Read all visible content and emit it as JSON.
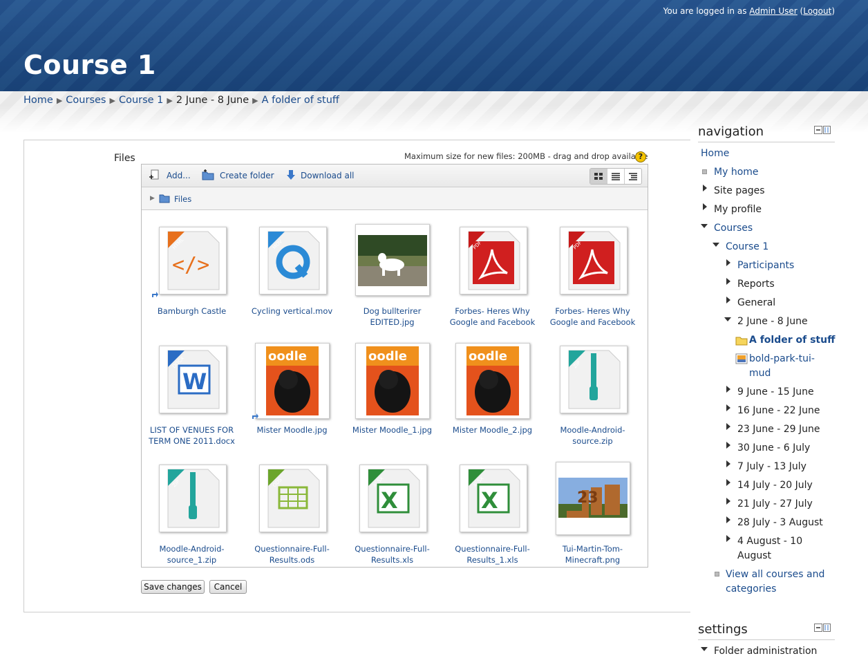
{
  "header": {
    "login_prefix": "You are logged in as",
    "user": "Admin User",
    "logout": "Logout",
    "course_title": "Course 1"
  },
  "breadcrumb": {
    "items": [
      "Home",
      "Courses",
      "Course 1",
      "2 June - 8 June",
      "A folder of stuff"
    ]
  },
  "files_form": {
    "label": "Files",
    "max_size": "Maximum size for new files: 200MB - drag and drop available",
    "toolbar": {
      "add": "Add...",
      "create_folder": "Create folder",
      "download_all": "Download all"
    },
    "path": "Files",
    "files": [
      {
        "name": "Bamburgh Castle",
        "icon": "html-file-icon"
      },
      {
        "name": "Cycling vertical.mov",
        "icon": "mov-file-icon"
      },
      {
        "name": "Dog bullterirer EDITED.jpg",
        "icon": "dog-photo-thumbnail"
      },
      {
        "name": "Forbes- Heres Why Google and Facebook",
        "icon": "pdf-file-icon"
      },
      {
        "name": "Forbes- Heres Why Google and Facebook",
        "icon": "pdf-file-icon"
      },
      {
        "name": "LIST OF VENUES FOR TERM ONE 2011.docx",
        "icon": "docx-file-icon"
      },
      {
        "name": "Mister Moodle.jpg",
        "icon": "dog-moodle-photo-thumbnail"
      },
      {
        "name": "Mister Moodle_1.jpg",
        "icon": "dog-moodle-photo-thumbnail"
      },
      {
        "name": "Mister Moodle_2.jpg",
        "icon": "dog-moodle-photo-thumbnail"
      },
      {
        "name": "Moodle-Android-source.zip",
        "icon": "zip-file-icon"
      },
      {
        "name": "Moodle-Android-source_1.zip",
        "icon": "zip-file-icon"
      },
      {
        "name": "Questionnaire-Full-Results.ods",
        "icon": "ods-file-icon"
      },
      {
        "name": "Questionnaire-Full-Results.xls",
        "icon": "xlsx-file-icon"
      },
      {
        "name": "Questionnaire-Full-Results_1.xls",
        "icon": "xlsx-file-icon"
      },
      {
        "name": "Tui-Martin-Tom-Minecraft.png",
        "icon": "minecraft-photo-thumbnail"
      }
    ],
    "save": "Save changes",
    "cancel": "Cancel"
  },
  "navigation": {
    "title": "navigation",
    "home": "Home",
    "my_home": "My home",
    "site_pages": "Site pages",
    "my_profile": "My profile",
    "courses": "Courses",
    "course1": "Course 1",
    "participants": "Participants",
    "reports": "Reports",
    "general": "General",
    "week_current": "2 June - 8 June",
    "folder": "A folder of stuff",
    "image_line1": "bold-park-tui-",
    "image_line2": "mud",
    "weeks": [
      "9 June - 15 June",
      "16 June - 22 June",
      "23 June - 29 June",
      "30 June - 6 July",
      "7 July - 13 July",
      "14 July - 20 July",
      "21 July - 27 July",
      "28 July - 3 August"
    ],
    "last_week_line1": "4 August - 10",
    "last_week_line2": "August",
    "view_all_line1": "View all courses and",
    "view_all_line2": "categories"
  },
  "settings": {
    "title": "settings",
    "folder_admin": "Folder administration"
  }
}
